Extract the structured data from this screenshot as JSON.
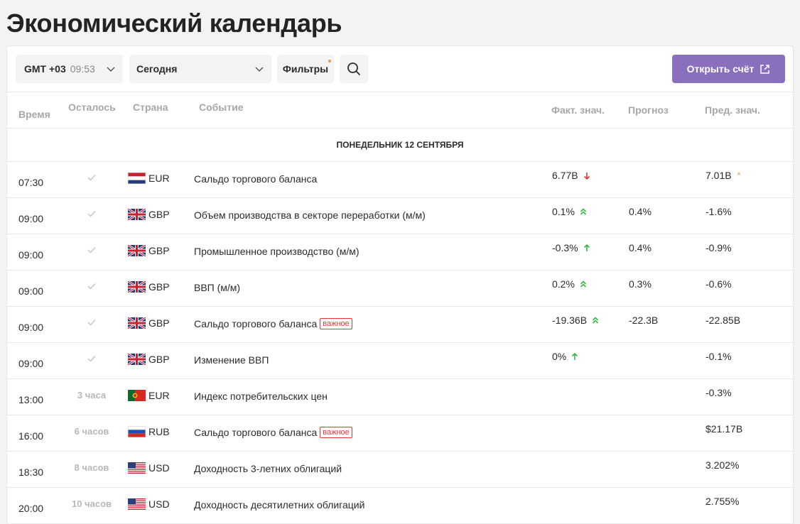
{
  "page": {
    "title": "Экономический календарь"
  },
  "toolbar": {
    "timezone_gmt": "GMT +03",
    "timezone_time": "09:53",
    "date_value": "Сегодня",
    "filters_label": "Фильтры",
    "open_account_label": "Открыть счёт"
  },
  "table": {
    "headers": {
      "time": "Время",
      "remaining": "Осталось",
      "country": "Страна",
      "event": "Событие",
      "actual": "Факт. знач.",
      "forecast": "Прогноз",
      "previous": "Пред. знач."
    },
    "day_label": "ПОНЕДЕЛЬНИК 12 СЕНТЯБРЯ",
    "important_label": "важное",
    "rows": [
      {
        "time": "07:30",
        "remaining": "",
        "done": true,
        "flag": "nl",
        "currency": "EUR",
        "event": "Сальдо торгового баланса",
        "important": false,
        "actual": "6.77B",
        "trend": "down",
        "forecast": "",
        "previous": "7.01B",
        "revised": true
      },
      {
        "time": "09:00",
        "remaining": "",
        "done": true,
        "flag": "gb",
        "currency": "GBP",
        "event": "Объем производства в секторе переработки (м/м)",
        "important": false,
        "actual": "0.1%",
        "trend": "double-up",
        "forecast": "0.4%",
        "previous": "-1.6%",
        "revised": false
      },
      {
        "time": "09:00",
        "remaining": "",
        "done": true,
        "flag": "gb",
        "currency": "GBP",
        "event": "Промышленное производство (м/м)",
        "important": false,
        "actual": "-0.3%",
        "trend": "up",
        "forecast": "0.4%",
        "previous": "-0.9%",
        "revised": false
      },
      {
        "time": "09:00",
        "remaining": "",
        "done": true,
        "flag": "gb",
        "currency": "GBP",
        "event": "ВВП (м/м)",
        "important": false,
        "actual": "0.2%",
        "trend": "double-up",
        "forecast": "0.3%",
        "previous": "-0.6%",
        "revised": false
      },
      {
        "time": "09:00",
        "remaining": "",
        "done": true,
        "flag": "gb",
        "currency": "GBP",
        "event": "Сальдо торгового баланса",
        "important": true,
        "actual": "-19.36B",
        "trend": "double-up",
        "forecast": "-22.3B",
        "previous": "-22.85B",
        "revised": false
      },
      {
        "time": "09:00",
        "remaining": "",
        "done": true,
        "flag": "gb",
        "currency": "GBP",
        "event": "Изменение ВВП",
        "important": false,
        "actual": "0%",
        "trend": "up",
        "forecast": "",
        "previous": "-0.1%",
        "revised": false
      },
      {
        "time": "13:00",
        "remaining": "3 часа",
        "done": false,
        "flag": "pt",
        "currency": "EUR",
        "event": "Индекс потребительских цен",
        "important": false,
        "actual": "",
        "trend": "",
        "forecast": "",
        "previous": "-0.3%",
        "revised": false
      },
      {
        "time": "16:00",
        "remaining": "6 часов",
        "done": false,
        "flag": "ru",
        "currency": "RUB",
        "event": "Сальдо торгового баланса",
        "important": true,
        "actual": "",
        "trend": "",
        "forecast": "",
        "previous": "$21.17B",
        "revised": false
      },
      {
        "time": "18:30",
        "remaining": "8 часов",
        "done": false,
        "flag": "us",
        "currency": "USD",
        "event": "Доходность 3-летних облигаций",
        "important": false,
        "actual": "",
        "trend": "",
        "forecast": "",
        "previous": "3.202%",
        "revised": false
      },
      {
        "time": "20:00",
        "remaining": "10 часов",
        "done": false,
        "flag": "us",
        "currency": "USD",
        "event": "Доходность десятилетних облигаций",
        "important": false,
        "actual": "",
        "trend": "",
        "forecast": "",
        "previous": "2.755%",
        "revised": false
      }
    ]
  },
  "colors": {
    "accent_button": "#8a6fbd",
    "trend_up": "#3bb54a",
    "trend_down": "#e53935",
    "badge": "#e53935",
    "revised_star": "#f59a4a"
  },
  "icons": {
    "chevron": "chevron-down-icon",
    "search": "search-icon",
    "external": "external-link-icon",
    "done": "check-icon"
  }
}
